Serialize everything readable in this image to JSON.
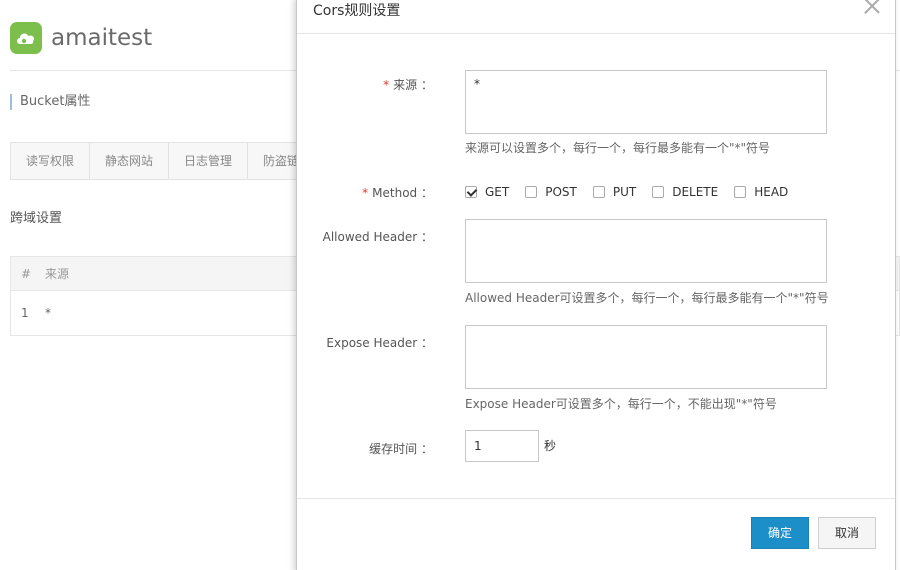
{
  "background": {
    "bucket_name": "amaitest",
    "section_title": "Bucket属性",
    "tabs": [
      "读写权限",
      "静态网站",
      "日志管理",
      "防盗链"
    ],
    "cors_title": "跨域设置",
    "table": {
      "headers": [
        "#",
        "来源"
      ],
      "rows": [
        [
          "1",
          "*"
        ]
      ]
    }
  },
  "modal": {
    "title": "Cors规则设置",
    "source": {
      "label": "来源 ：",
      "value": "*",
      "hint": "来源可以设置多个，每行一个，每行最多能有一个\"*\"符号"
    },
    "method": {
      "label": "Method ：",
      "options": [
        {
          "label": "GET",
          "checked": true
        },
        {
          "label": "POST",
          "checked": false
        },
        {
          "label": "PUT",
          "checked": false
        },
        {
          "label": "DELETE",
          "checked": false
        },
        {
          "label": "HEAD",
          "checked": false
        }
      ]
    },
    "allowed_header": {
      "label": "Allowed Header ：",
      "value": "",
      "hint": "Allowed Header可设置多个，每行一个，每行最多能有一个\"*\"符号"
    },
    "expose_header": {
      "label": "Expose Header ：",
      "value": "",
      "hint": "Expose Header可设置多个，每行一个，不能出现\"*\"符号"
    },
    "cache_time": {
      "label": "缓存时间 ：",
      "value": "1",
      "unit": "秒"
    },
    "buttons": {
      "ok": "确定",
      "cancel": "取消"
    }
  },
  "colors": {
    "primary": "#1c8ec8",
    "required": "#e53a2e",
    "logo": "#7cbf4d"
  }
}
